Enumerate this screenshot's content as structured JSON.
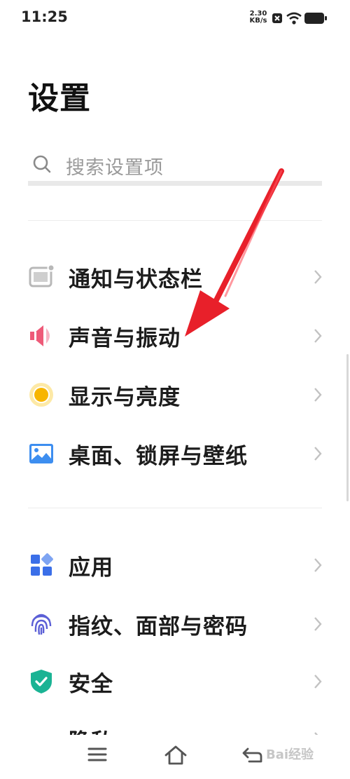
{
  "status_bar": {
    "time": "11:25",
    "net_speed_value": "2.30",
    "net_speed_unit": "KB/s",
    "icons": [
      "sim-off-icon",
      "wifi-icon",
      "battery-icon"
    ]
  },
  "page": {
    "title": "设置"
  },
  "search": {
    "placeholder": "搜索设置项",
    "icon": "search-icon"
  },
  "groups": [
    {
      "items": [
        {
          "label": "通知与状态栏",
          "icon": "notification-bar-icon",
          "color": "#b5b5b5"
        },
        {
          "label": "声音与振动",
          "icon": "speaker-icon",
          "color": "#ee5a78"
        },
        {
          "label": "显示与亮度",
          "icon": "brightness-icon",
          "color": "#f7b500"
        },
        {
          "label": "桌面、锁屏与壁纸",
          "icon": "wallpaper-icon",
          "color": "#3d8ef0"
        }
      ]
    },
    {
      "items": [
        {
          "label": "应用",
          "icon": "apps-icon",
          "color": "#3b6fe8"
        },
        {
          "label": "指纹、面部与密码",
          "icon": "fingerprint-icon",
          "color": "#5b5fd6"
        },
        {
          "label": "安全",
          "icon": "shield-icon",
          "color": "#1ab394"
        },
        {
          "label": "隐私",
          "icon": "privacy-icon",
          "color": "#3b6fe8"
        }
      ]
    }
  ],
  "nav_bar": {
    "items": [
      "menu-icon",
      "home-icon",
      "back-icon"
    ]
  },
  "annotation": {
    "type": "red-arrow",
    "color": "#e8202a",
    "points_to": "声音与振动"
  },
  "watermark": "Bai经验"
}
